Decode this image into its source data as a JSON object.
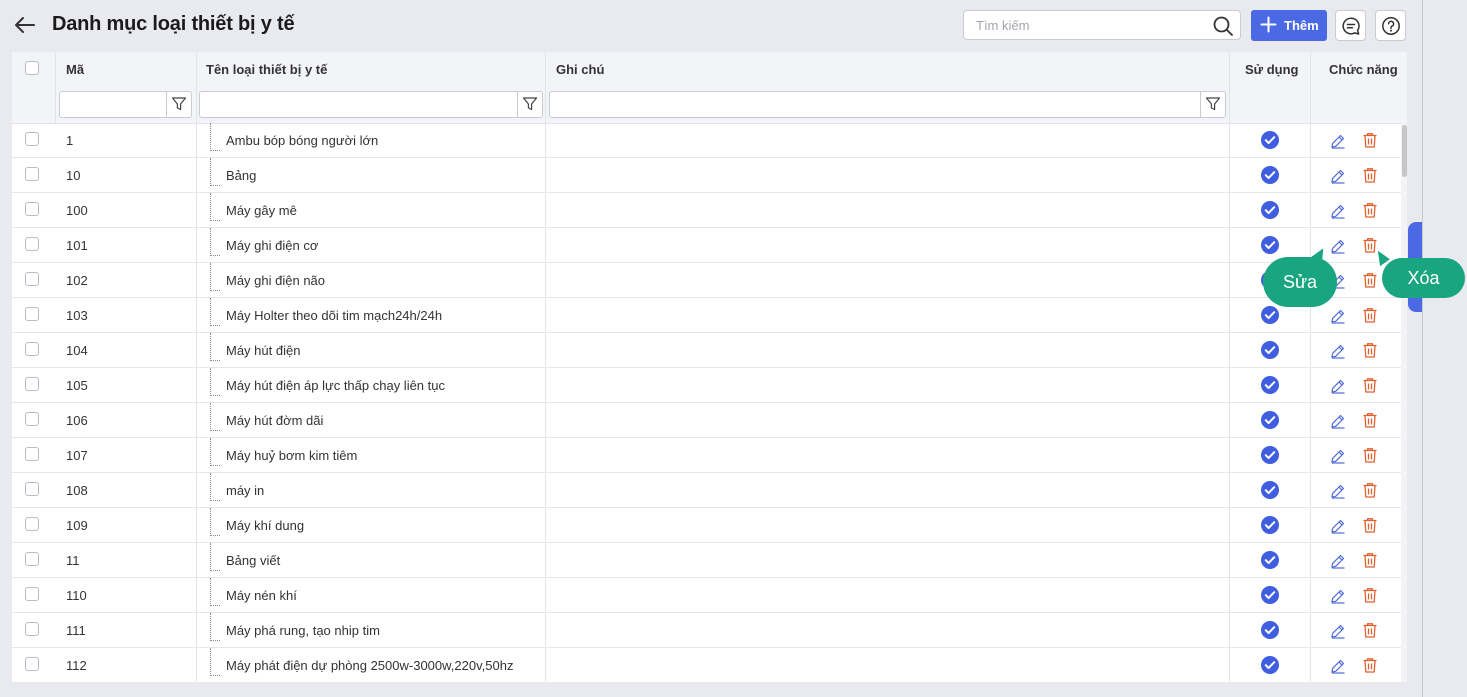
{
  "header": {
    "title": "Danh mục loại thiết bị y tế",
    "search_placeholder": "Tìm kiếm",
    "add_label": "Thêm"
  },
  "columns": {
    "code": "Mã",
    "name": "Tên loại thiết bị y tế",
    "note": "Ghi chú",
    "in_use": "Sử dụng",
    "actions": "Chức năng"
  },
  "rows": [
    {
      "code": "1",
      "name": "Ambu bóp bóng người lớn",
      "in_use": true
    },
    {
      "code": "10",
      "name": "Bảng",
      "in_use": true
    },
    {
      "code": "100",
      "name": "Máy gây mê",
      "in_use": true
    },
    {
      "code": "101",
      "name": "Máy ghi điện cơ",
      "in_use": true
    },
    {
      "code": "102",
      "name": "Máy ghi điện não",
      "in_use": true
    },
    {
      "code": "103",
      "name": "Máy Holter theo dõi tim mạch24h/24h",
      "in_use": true
    },
    {
      "code": "104",
      "name": "Máy hút điện",
      "in_use": true
    },
    {
      "code": "105",
      "name": "Máy hút điện áp lực thấp chạy liên tục",
      "in_use": true
    },
    {
      "code": "106",
      "name": "Máy hút đờm dãi",
      "in_use": true
    },
    {
      "code": "107",
      "name": "Máy huỷ bơm kim tiêm",
      "in_use": true
    },
    {
      "code": "108",
      "name": "máy in",
      "in_use": true
    },
    {
      "code": "109",
      "name": "Máy khí dung",
      "in_use": true
    },
    {
      "code": "11",
      "name": "Bảng viết",
      "in_use": true
    },
    {
      "code": "110",
      "name": "Máy nén khí",
      "in_use": true
    },
    {
      "code": "111",
      "name": "Máy phá rung, tạo nhip tim",
      "in_use": true
    },
    {
      "code": "112",
      "name": "Máy phát điện dự phòng 2500w-3000w,220v,50hz",
      "in_use": true
    }
  ],
  "callouts": {
    "edit": "Sửa",
    "delete": "Xóa"
  },
  "colors": {
    "primary": "#4c69e5",
    "check": "#3f5ee0",
    "delete": "#e0602f",
    "callout": "#1aa581"
  },
  "icons": {
    "back": "arrow-left-icon",
    "search": "search-icon",
    "add": "plus-icon",
    "comment": "comment-icon",
    "help": "help-icon",
    "filter": "filter-icon",
    "in_use": "check-circle-icon",
    "edit": "pencil-icon",
    "delete": "trash-icon"
  }
}
